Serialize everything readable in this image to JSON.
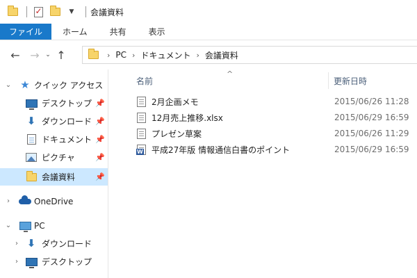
{
  "window": {
    "title": "会議資料"
  },
  "ribbon": {
    "tabs": [
      "ファイル",
      "ホーム",
      "共有",
      "表示"
    ]
  },
  "address": {
    "path": [
      "PC",
      "ドキュメント",
      "会議資料"
    ]
  },
  "sidebar": {
    "quick_access": "クイック アクセス",
    "items": [
      {
        "label": "デスクトップ",
        "icon": "desktop-icon"
      },
      {
        "label": "ダウンロード",
        "icon": "download-icon"
      },
      {
        "label": "ドキュメント",
        "icon": "documents-icon"
      },
      {
        "label": "ピクチャ",
        "icon": "pictures-icon"
      },
      {
        "label": "会議資料",
        "icon": "folder-icon"
      }
    ],
    "onedrive": "OneDrive",
    "pc": "PC",
    "pc_items": [
      {
        "label": "ダウンロード",
        "icon": "download-icon"
      },
      {
        "label": "デスクトップ",
        "icon": "desktop-icon"
      }
    ]
  },
  "columns": {
    "name": "名前",
    "modified": "更新日時"
  },
  "files": [
    {
      "name": "2月企画メモ",
      "date": "2015/06/26 11:28",
      "icon": "text-file-icon"
    },
    {
      "name": "12月売上推移.xlsx",
      "date": "2015/06/29 16:59",
      "icon": "text-file-icon"
    },
    {
      "name": "プレゼン草案",
      "date": "2015/06/26 11:29",
      "icon": "text-file-icon"
    },
    {
      "name": "平成27年版 情報通信白書のポイント",
      "date": "2015/06/29 16:59",
      "icon": "word-file-icon"
    }
  ]
}
